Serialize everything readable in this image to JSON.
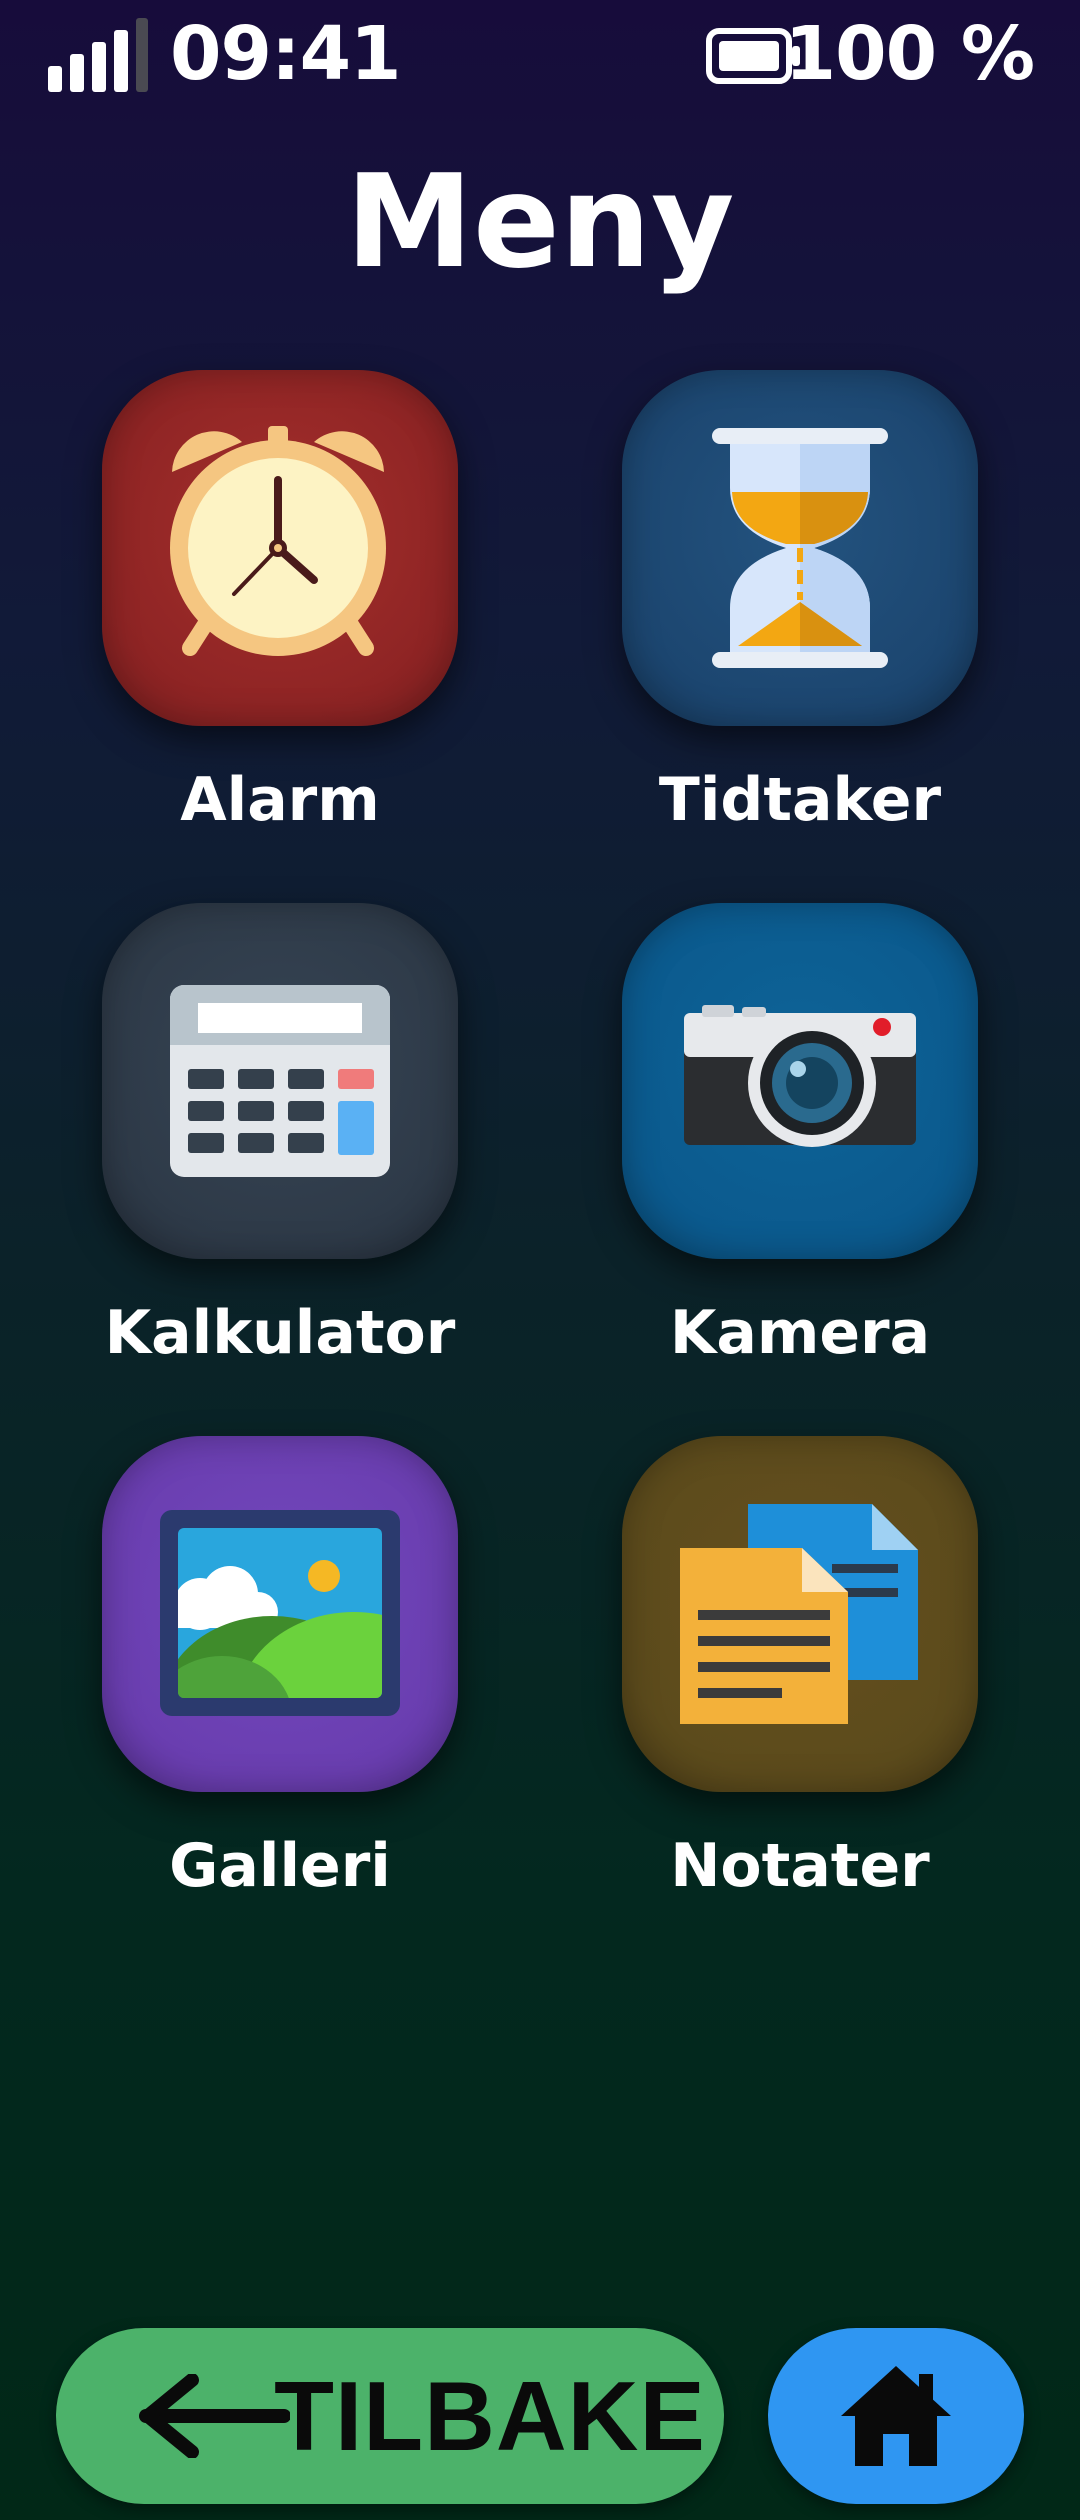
{
  "status_bar": {
    "time": "09:41",
    "battery_text": "100 %",
    "signal_icon": "signal-strength-icon",
    "battery_icon": "battery-icon",
    "signal_level": 0.8,
    "battery_level": 1.0
  },
  "page": {
    "title": "Meny"
  },
  "apps": [
    {
      "label": "Alarm",
      "icon": "alarm-clock-icon",
      "color": "#9b2a2a"
    },
    {
      "label": "Tidtaker",
      "icon": "hourglass-icon",
      "color": "#1c4670"
    },
    {
      "label": "Kalkulator",
      "icon": "calculator-icon",
      "color": "#2e3a48"
    },
    {
      "label": "Kamera",
      "icon": "camera-icon",
      "color": "#0b5a8e"
    },
    {
      "label": "Galleri",
      "icon": "picture-icon",
      "color": "#6a3eb0"
    },
    {
      "label": "Notater",
      "icon": "notes-icon",
      "color": "#5c4b1c"
    }
  ],
  "navigation": {
    "back_label": "TILBAKE",
    "back_icon": "arrow-left-icon",
    "back_color": "#4cb26a",
    "home_icon": "home-icon",
    "home_color": "#2f96f2"
  }
}
